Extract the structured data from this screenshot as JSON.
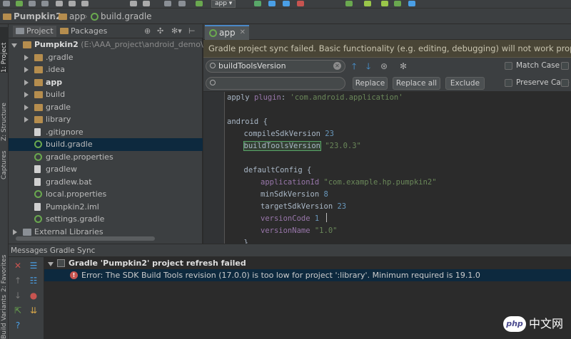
{
  "toolbar": {
    "run_config": "app",
    "icons": [
      "save-icon",
      "sync-icon",
      "undo-icon",
      "redo-icon",
      "cut-icon",
      "copy-icon",
      "paste-icon",
      "find-icon",
      "replace-icon",
      "back-icon",
      "forward-icon",
      "build-icon",
      "run-icon",
      "debug-icon",
      "attach-icon",
      "stop-icon",
      "sync-gradle-icon",
      "avd-manager-icon",
      "sdk-manager-icon",
      "android-device-monitor-icon",
      "help-icon"
    ]
  },
  "navbar": {
    "project": "Pumpkin2",
    "module": "app",
    "file": "build.gradle"
  },
  "left_strip": {
    "tab_project": "1: Project",
    "tab_structure": "Z: Structure",
    "tab_captures": "Captures",
    "tab_favorites": "2: Favorites",
    "tab_build_variants": "Build Variants"
  },
  "project_panel": {
    "tab_project": "Project",
    "tab_packages": "Packages",
    "tree": [
      {
        "label": "Pumpkin2",
        "hint": "(E:\\AAA_project\\android_demo\\AS_",
        "type": "folder",
        "expanded": true,
        "bold": true,
        "depth": 0
      },
      {
        "label": ".gradle",
        "type": "folder",
        "depth": 1
      },
      {
        "label": ".idea",
        "type": "folder",
        "depth": 1
      },
      {
        "label": "app",
        "type": "folder",
        "bold": true,
        "depth": 1
      },
      {
        "label": "build",
        "type": "folder",
        "depth": 1
      },
      {
        "label": "gradle",
        "type": "folder",
        "depth": 1
      },
      {
        "label": "library",
        "type": "folder",
        "depth": 1
      },
      {
        "label": ".gitignore",
        "type": "file",
        "depth": 1
      },
      {
        "label": "build.gradle",
        "type": "gradle",
        "depth": 1,
        "selected": true
      },
      {
        "label": "gradle.properties",
        "type": "gradle",
        "depth": 1
      },
      {
        "label": "gradlew",
        "type": "file",
        "depth": 1
      },
      {
        "label": "gradlew.bat",
        "type": "file",
        "depth": 1
      },
      {
        "label": "local.properties",
        "type": "gradle",
        "depth": 1
      },
      {
        "label": "Pumpkin2.iml",
        "type": "file",
        "depth": 1
      },
      {
        "label": "settings.gradle",
        "type": "gradle",
        "depth": 1
      },
      {
        "label": "External Libraries",
        "type": "lib",
        "depth": 0
      }
    ]
  },
  "editor": {
    "tab_label": "app",
    "banner": "Gradle project sync failed. Basic functionality (e.g. editing, debugging) will not work properly.",
    "find": {
      "search_value": "buildToolsVersion",
      "replace_value": "",
      "replace_label": "Replace",
      "replace_all_label": "Replace all",
      "exclude_label": "Exclude",
      "match_case_label": "Match Case",
      "preserve_case_label": "Preserve Case"
    },
    "code": [
      {
        "indent": 0,
        "parts": [
          [
            "plain",
            "apply "
          ],
          [
            "key",
            "plugin"
          ],
          [
            "plain",
            ": "
          ],
          [
            "str",
            "'com.android.application'"
          ]
        ]
      },
      {
        "indent": 0,
        "parts": []
      },
      {
        "indent": 0,
        "parts": [
          [
            "plain",
            "android {"
          ]
        ]
      },
      {
        "indent": 1,
        "parts": [
          [
            "plain",
            "compileSdkVersion "
          ],
          [
            "num",
            "23"
          ]
        ]
      },
      {
        "indent": 1,
        "parts": [
          [
            "hl",
            "buildToolsVersion"
          ],
          [
            "plain",
            " "
          ],
          [
            "str",
            "\"23.0.3\""
          ]
        ]
      },
      {
        "indent": 0,
        "parts": []
      },
      {
        "indent": 1,
        "parts": [
          [
            "plain",
            "defaultConfig {"
          ]
        ]
      },
      {
        "indent": 2,
        "parts": [
          [
            "key",
            "applicationId "
          ],
          [
            "str",
            "\"com.example.hp.pumpkin2\""
          ]
        ]
      },
      {
        "indent": 2,
        "parts": [
          [
            "plain",
            "minSdkVersion "
          ],
          [
            "num",
            "8"
          ]
        ]
      },
      {
        "indent": 2,
        "parts": [
          [
            "plain",
            "targetSdkVersion "
          ],
          [
            "num",
            "23"
          ]
        ]
      },
      {
        "indent": 2,
        "parts": [
          [
            "key",
            "versionCode "
          ],
          [
            "num",
            "1"
          ],
          [
            "caret",
            ""
          ]
        ]
      },
      {
        "indent": 2,
        "parts": [
          [
            "key",
            "versionName "
          ],
          [
            "str",
            "\"1.0\""
          ]
        ]
      },
      {
        "indent": 1,
        "parts": [
          [
            "plain",
            "}"
          ]
        ]
      }
    ]
  },
  "messages": {
    "header": "Messages Gradle Sync",
    "title": "Gradle 'Pumpkin2' project refresh failed",
    "error": "Error:  The SDK Build Tools revision (17.0.0) is too low for project ':library'. Minimum required is 19.1.0"
  },
  "watermark": {
    "badge": "php",
    "text": "中文网"
  },
  "colors": {
    "background": "#2b2b2b",
    "panel": "#3c3f41",
    "selection": "#0d293e",
    "banner": "#494536",
    "accent": "#4a88c7",
    "error": "#c75450"
  }
}
